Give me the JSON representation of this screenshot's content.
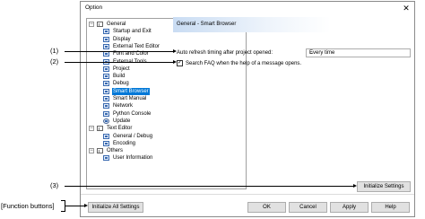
{
  "window": {
    "title": "Option",
    "close_glyph": "✕"
  },
  "tree": [
    {
      "name": "tree-general",
      "label": "General",
      "expander": "−",
      "icon": "folder"
    },
    {
      "name": "tree-startup-exit",
      "label": "Startup and Exit",
      "icon": "page"
    },
    {
      "name": "tree-display",
      "label": "Display",
      "icon": "page"
    },
    {
      "name": "tree-external-text-editor",
      "label": "External Text Editor",
      "icon": "page"
    },
    {
      "name": "tree-font-color",
      "label": "Font and Color",
      "icon": "page"
    },
    {
      "name": "tree-external-tools",
      "label": "External Tools",
      "icon": "page"
    },
    {
      "name": "tree-project",
      "label": "Project",
      "icon": "page"
    },
    {
      "name": "tree-build",
      "label": "Build",
      "icon": "page"
    },
    {
      "name": "tree-debug",
      "label": "Debug",
      "icon": "page"
    },
    {
      "name": "tree-smart-browser",
      "label": "Smart Browser",
      "icon": "page",
      "selected": true
    },
    {
      "name": "tree-smart-manual",
      "label": "Smart Manual",
      "icon": "page"
    },
    {
      "name": "tree-network",
      "label": "Network",
      "icon": "page"
    },
    {
      "name": "tree-python-console",
      "label": "Python Console",
      "icon": "page"
    },
    {
      "name": "tree-update",
      "label": "Update",
      "icon": "gear"
    },
    {
      "name": "tree-text-editor",
      "label": "Text Editor",
      "expander": "−",
      "icon": "folder"
    },
    {
      "name": "tree-general-debug",
      "label": "General / Debug",
      "icon": "page"
    },
    {
      "name": "tree-encoding",
      "label": "Encoding",
      "icon": "page"
    },
    {
      "name": "tree-others",
      "label": "Others",
      "expander": "−",
      "icon": "folder"
    },
    {
      "name": "tree-user-information",
      "label": "User Information",
      "icon": "page"
    }
  ],
  "panel": {
    "header": "General - Smart Browser",
    "auto_refresh_label": "Auto refresh timing after project opened:",
    "auto_refresh_value": "Every time",
    "search_faq_label": "Search FAQ when the help of a message opens.",
    "search_faq_checked": "✓",
    "initialize_settings": "Initialize Settings"
  },
  "footer": {
    "initialize_all": "Initialize All Settings",
    "ok": "OK",
    "cancel": "Cancel",
    "apply": "Apply",
    "help": "Help"
  },
  "callouts": {
    "c1": "(1)",
    "c2": "(2)",
    "c3": "(3)",
    "function_buttons": "[Function buttons]"
  }
}
